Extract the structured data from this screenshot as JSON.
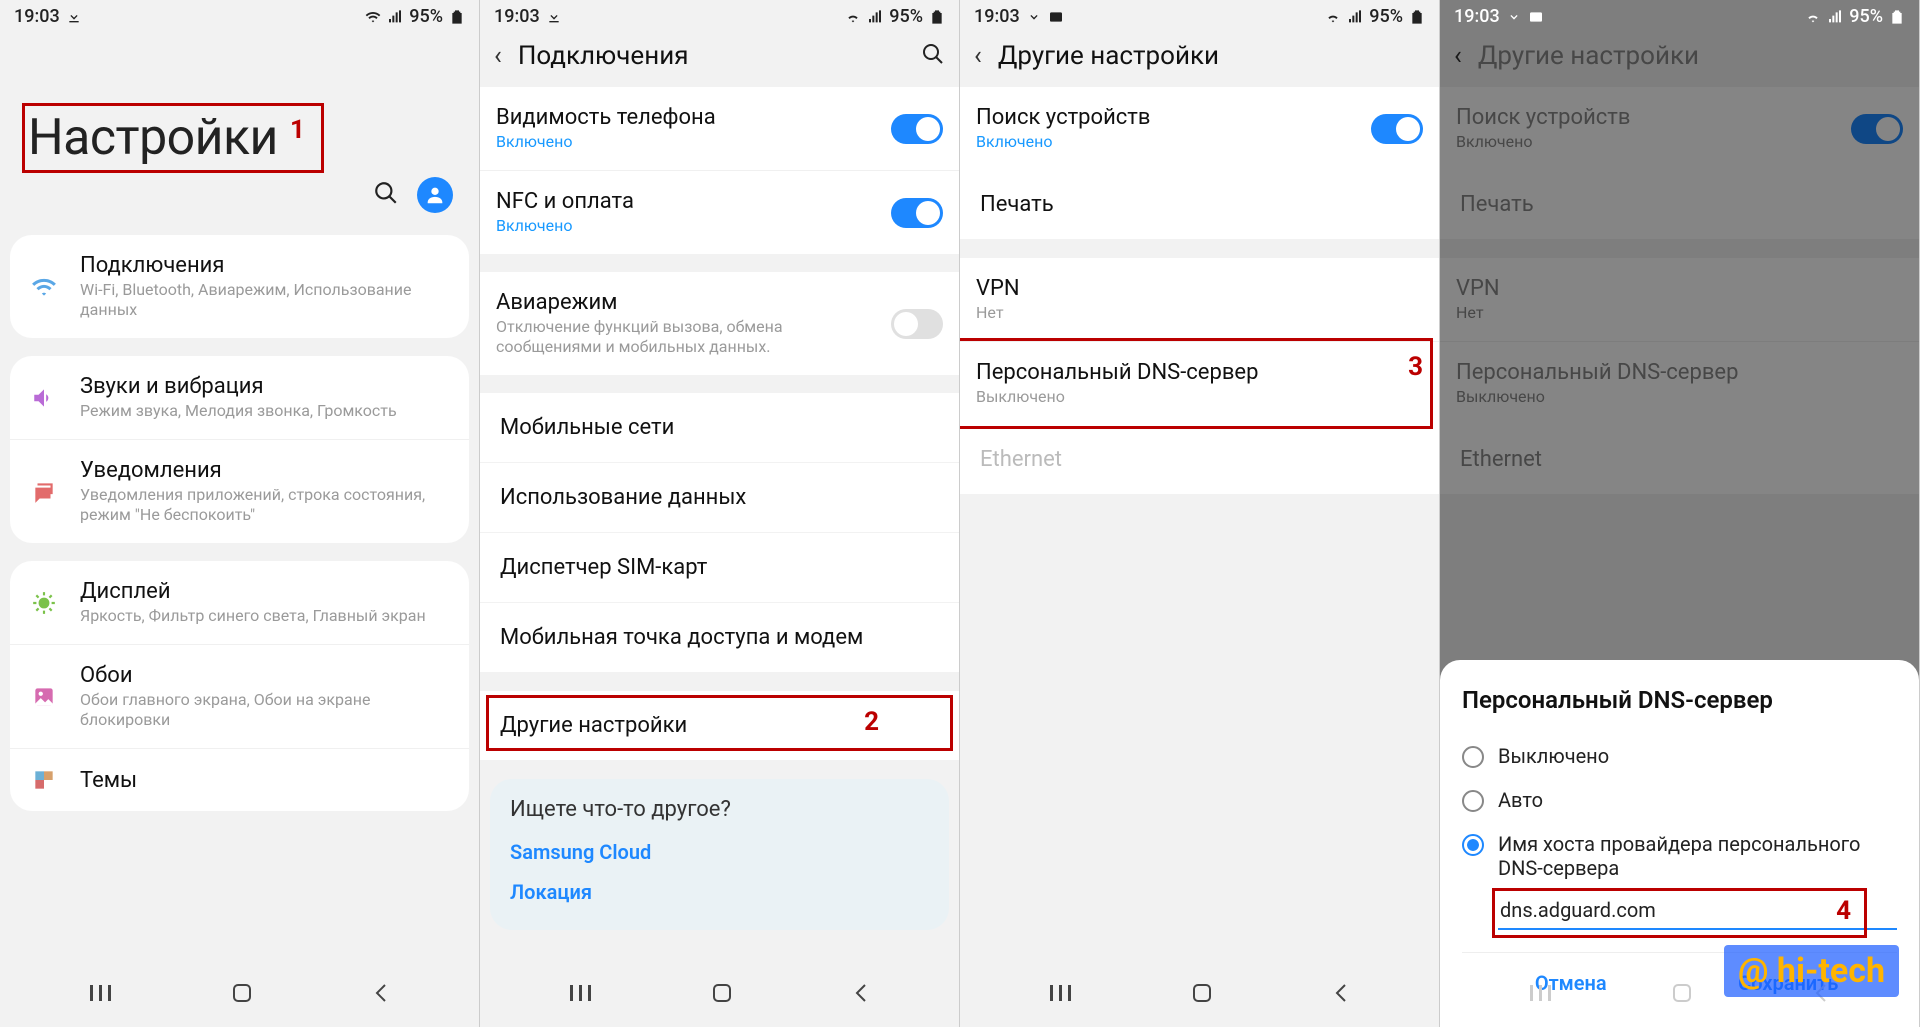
{
  "status": {
    "time": "19:03",
    "battery": "95%"
  },
  "annotations": {
    "n1": "1",
    "n2": "2",
    "n3": "3",
    "n4": "4"
  },
  "watermark": "@ hi-tech",
  "nav": {
    "recents": "|||",
    "home": "◯",
    "back": "⟨"
  },
  "s1": {
    "title": "Настройки",
    "items": [
      {
        "title": "Подключения",
        "sub": "Wi-Fi, Bluetooth, Авиарежим, Использование данных",
        "icon": "wifi"
      },
      {
        "title": "Звуки и вибрация",
        "sub": "Режим звука, Мелодия звонка, Громкость",
        "icon": "sound"
      },
      {
        "title": "Уведомления",
        "sub": "Уведомления приложений, строка состояния, режим \"Не беспокоить\"",
        "icon": "notif"
      },
      {
        "title": "Дисплей",
        "sub": "Яркость, Фильтр синего света, Главный экран",
        "icon": "display"
      },
      {
        "title": "Обои",
        "sub": "Обои главного экрана, Обои на экране блокировки",
        "icon": "wall"
      },
      {
        "title": "Темы",
        "sub": "",
        "icon": "themes"
      }
    ]
  },
  "s2": {
    "title": "Подключения",
    "group1": [
      {
        "title": "Видимость телефона",
        "sub": "Включено",
        "toggle": true
      },
      {
        "title": "NFC и оплата",
        "sub": "Включено",
        "toggle": true
      }
    ],
    "group2": [
      {
        "title": "Авиарежим",
        "sub": "Отключение функций вызова, обмена сообщениями и мобильных данных.",
        "toggle": false
      }
    ],
    "group3": [
      "Мобильные сети",
      "Использование данных",
      "Диспетчер SIM-карт",
      "Мобильная точка доступа и модем"
    ],
    "other": "Другие настройки",
    "footer_title": "Ищете что-то другое?",
    "footer_links": [
      "Samsung Cloud",
      "Локация"
    ]
  },
  "s3": {
    "title": "Другие настройки",
    "rows": [
      {
        "title": "Поиск устройств",
        "sub": "Включено",
        "toggle": true
      },
      {
        "title": "Печать"
      },
      {
        "title": "VPN",
        "sub": "Нет"
      },
      {
        "title": "Персональный DNS-сервер",
        "sub": "Выключено"
      },
      {
        "title": "Ethernet",
        "muted": true
      }
    ]
  },
  "s4": {
    "title": "Другие настройки",
    "rows": [
      {
        "title": "Поиск устройств",
        "sub": "Включено",
        "toggle": true
      },
      {
        "title": "Печать"
      },
      {
        "title": "VPN",
        "sub": "Нет"
      },
      {
        "title": "Персональный DNS-сервер",
        "sub": "Выключено"
      },
      {
        "title": "Ethernet",
        "muted": true
      }
    ],
    "dialog": {
      "title": "Персональный DNS-сервер",
      "opt_off": "Выключено",
      "opt_auto": "Авто",
      "opt_host": "Имя хоста провайдера персонального DNS-сервера",
      "value": "dns.adguard.com",
      "cancel": "Отмена",
      "save": "Сохранить"
    }
  }
}
